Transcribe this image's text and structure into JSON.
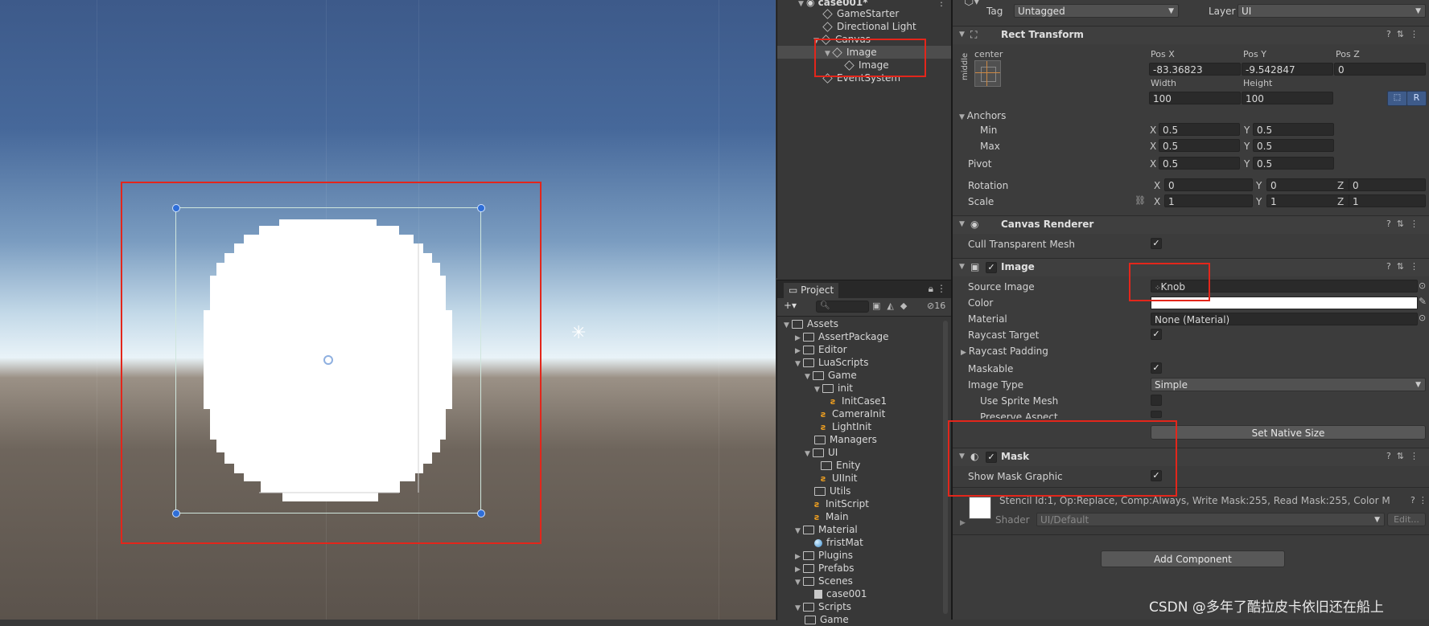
{
  "hierarchy": {
    "items": [
      {
        "label": "case001*",
        "kind": "scene"
      },
      {
        "label": "GameStarter"
      },
      {
        "label": "Directional Light"
      },
      {
        "label": "Canvas"
      },
      {
        "label": "Image"
      },
      {
        "label": "Image"
      },
      {
        "label": "EventSystem"
      }
    ]
  },
  "project": {
    "tab_label": "Project",
    "hidden_count": "16",
    "items": [
      {
        "label": "Assets",
        "type": "folder"
      },
      {
        "label": "AssertPackage",
        "type": "folder"
      },
      {
        "label": "Editor",
        "type": "folder"
      },
      {
        "label": "LuaScripts",
        "type": "folder"
      },
      {
        "label": "Game",
        "type": "folder"
      },
      {
        "label": "init",
        "type": "folder"
      },
      {
        "label": "InitCase1",
        "type": "lua"
      },
      {
        "label": "CameraInit",
        "type": "lua"
      },
      {
        "label": "LightInit",
        "type": "lua"
      },
      {
        "label": "Managers",
        "type": "folder"
      },
      {
        "label": "UI",
        "type": "folder"
      },
      {
        "label": "Enity",
        "type": "folder"
      },
      {
        "label": "UIInit",
        "type": "lua"
      },
      {
        "label": "Utils",
        "type": "folder"
      },
      {
        "label": "InitScript",
        "type": "lua"
      },
      {
        "label": "Main",
        "type": "lua"
      },
      {
        "label": "Material",
        "type": "folder"
      },
      {
        "label": "fristMat",
        "type": "material"
      },
      {
        "label": "Plugins",
        "type": "folder"
      },
      {
        "label": "Prefabs",
        "type": "folder"
      },
      {
        "label": "Scenes",
        "type": "folder"
      },
      {
        "label": "case001",
        "type": "scene"
      },
      {
        "label": "Scripts",
        "type": "folder"
      },
      {
        "label": "Game",
        "type": "folder"
      }
    ]
  },
  "inspector": {
    "tag_label": "Tag",
    "tag_value": "Untagged",
    "layer_label": "Layer",
    "layer_value": "UI",
    "rect_transform": {
      "title": "Rect Transform",
      "anchor_h": "center",
      "anchor_v": "middle",
      "pos_x_label": "Pos X",
      "pos_x": "-83.36823",
      "pos_y_label": "Pos Y",
      "pos_y": "-9.542847",
      "pos_z_label": "Pos Z",
      "pos_z": "0",
      "width_label": "Width",
      "width": "100",
      "height_label": "Height",
      "height": "100",
      "r_button": "R",
      "anchors_label": "Anchors",
      "min_label": "Min",
      "min_x": "0.5",
      "min_y": "0.5",
      "max_label": "Max",
      "max_x": "0.5",
      "max_y": "0.5",
      "pivot_label": "Pivot",
      "pivot_x": "0.5",
      "pivot_y": "0.5",
      "rotation_label": "Rotation",
      "rot_x": "0",
      "rot_y": "0",
      "rot_z": "0",
      "scale_label": "Scale",
      "scale_x": "1",
      "scale_y": "1",
      "scale_z": "1"
    },
    "canvas_renderer": {
      "title": "Canvas Renderer",
      "cull_label": "Cull Transparent Mesh"
    },
    "image": {
      "title": "Image",
      "source_label": "Source Image",
      "source_value": "Knob",
      "color_label": "Color",
      "material_label": "Material",
      "material_value": "None (Material)",
      "raycast_target_label": "Raycast Target",
      "raycast_padding_label": "Raycast Padding",
      "maskable_label": "Maskable",
      "image_type_label": "Image Type",
      "image_type_value": "Simple",
      "use_sprite_mesh_label": "Use Sprite Mesh",
      "preserve_aspect_label": "Preserve Aspect",
      "set_native_size": "Set Native Size"
    },
    "mask": {
      "title": "Mask",
      "show_mask_graphic_label": "Show Mask Graphic"
    },
    "material_preview": {
      "description": "Stencil Id:1, Op:Replace, Comp:Always, Write Mask:255, Read Mask:255, Color M",
      "shader_label": "Shader",
      "shader_value": "UI/Default",
      "edit_label": "Edit..."
    },
    "add_component": "Add Component"
  },
  "xyz": {
    "x": "X",
    "y": "Y",
    "z": "Z"
  },
  "watermark": "CSDN @多年了酷拉皮卡依旧还在船上",
  "colors": {
    "highlight_red": "#e3261b",
    "handle_blue": "#2f6ed8"
  }
}
